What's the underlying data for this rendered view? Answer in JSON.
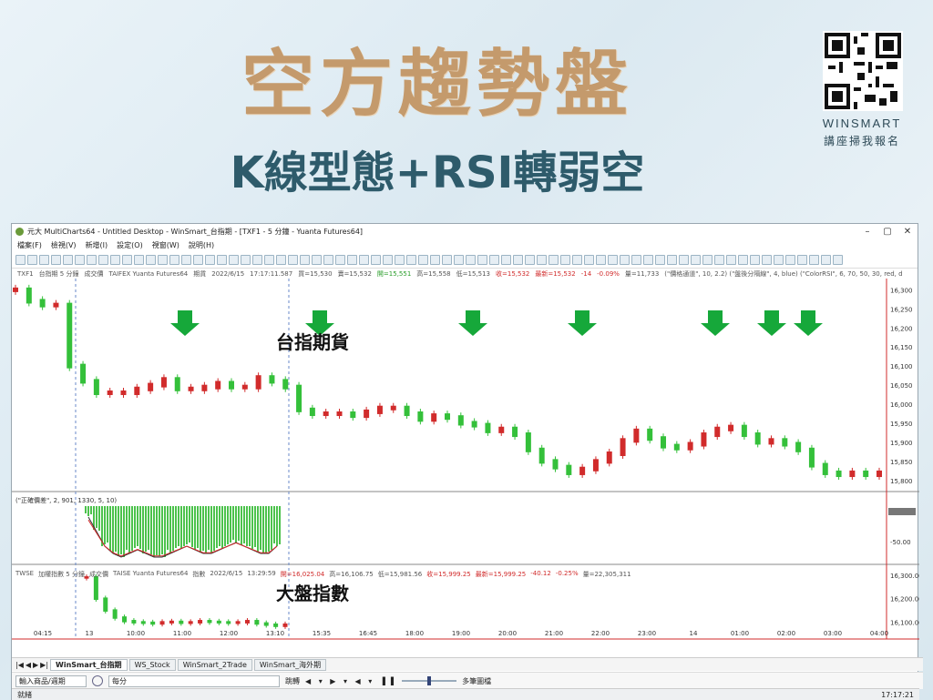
{
  "banner": {
    "title": "空方趨勢盤",
    "subtitle": "K線型態+RSI轉弱空",
    "brand": "WINSMART",
    "brand_sub": "講座掃我報名"
  },
  "window": {
    "title": "元大 MultiCharts64 - Untitled Desktop - WinSmart_台指期 - [TXF1 - 5 分鐘 - Yuanta Futures64]",
    "menu": [
      "檔案(F)",
      "檢視(V)",
      "新增(I)",
      "設定(O)",
      "視窗(W)",
      "說明(H)"
    ],
    "chart_info": {
      "symbol": "TXF1",
      "name": "台指期 5 分鐘",
      "vol_label": "成交價",
      "exchange": "TAIFEX Yuanta Futures64",
      "type": "期貨",
      "date": "2022/6/15",
      "time": "17:17:11.587",
      "buy": "買=15,530",
      "sell": "賣=15,532",
      "open": "開=15,551",
      "high": "高=15,558",
      "low": "低=15,513",
      "close": "收=15,532",
      "last": "最新=15,532",
      "change": "-14",
      "change_pct": "-0.09%",
      "volume": "量=11,733",
      "studies": "(\"價格通道\", 10, 2.2) (\"盤後分隔線\", 4, blue) (\"ColorRSI\", 6, 70, 50, 30, red, d"
    },
    "rsi_info": "(\"正確價差\", 2, 901, 1330, 5, 10)",
    "index_info": {
      "symbol": "TWSE",
      "name": "加權指數 5 分鐘",
      "vol_label": "成交價",
      "exchange": "TAISE Yuanta Futures64",
      "type": "指數",
      "date": "2022/6/15",
      "time": "13:29:59",
      "open": "開=16,025.04",
      "high": "高=16,106.75",
      "low": "低=15,981.56",
      "close": "收=15,999.25",
      "last": "最新=15,999.25",
      "change": "-40.12",
      "change_pct": "-0.25%",
      "volume": "量=22,305,311"
    },
    "tabs": [
      "WinSmart_台指期",
      "WS_Stock",
      "WinSmart_2Trade",
      "WinSmart_海外期"
    ],
    "bottom": {
      "input_placeholder": "輸入商品/週期",
      "period": "每分",
      "jump": "跳轉",
      "status": "多筆圖檔"
    },
    "status_left": "就緒",
    "status_time": "17:17:21"
  },
  "annotations": {
    "futures": "台指期貨",
    "index": "大盤指數"
  },
  "colors": {
    "up": "#d12b2b",
    "down": "#34c03a",
    "arrow": "#16a83a",
    "rsi_bar": "#4cc24c"
  },
  "chart_data": [
    {
      "type": "line",
      "title": "台指期貨",
      "x_ticks": [
        "04:15",
        "13",
        "10:00",
        "11:00",
        "12:00",
        "13:10",
        "15:35",
        "16:45",
        "18:00",
        "19:00",
        "20:00",
        "21:00",
        "22:00",
        "23:00",
        "14",
        "01:00",
        "02:00",
        "03:00",
        "04:00"
      ],
      "y_ticks": [
        16300,
        16250,
        16200,
        16150,
        16100,
        16050,
        16000,
        15950,
        15900,
        15850,
        15800
      ],
      "ylim": [
        15790,
        16320
      ],
      "close": [
        16300,
        16270,
        16260,
        16260,
        16100,
        16060,
        16030,
        16030,
        16030,
        16040,
        16050,
        16065,
        16040,
        16040,
        16045,
        16055,
        16045,
        16045,
        16070,
        16060,
        16045,
        15985,
        15975,
        15975,
        15975,
        15970,
        15980,
        15990,
        15990,
        15975,
        15960,
        15970,
        15965,
        15950,
        15945,
        15930,
        15935,
        15920,
        15880,
        15850,
        15835,
        15820,
        15830,
        15850,
        15870,
        15905,
        15930,
        15910,
        15890,
        15885,
        15895,
        15920,
        15935,
        15940,
        15920,
        15900,
        15905,
        15895,
        15880,
        15840,
        15820,
        15815,
        15820,
        15815,
        15820
      ],
      "arrows_at": [
        190,
        338,
        506,
        626,
        772,
        834,
        874
      ]
    },
    {
      "type": "bar",
      "title": "RSI",
      "y_ticks": [
        -50
      ],
      "bars": "green histogram 09:00-13:30",
      "values": [
        -2,
        -6,
        -10,
        -12,
        -13,
        -12,
        -11,
        -12,
        -13,
        -13,
        -12,
        -11,
        -10,
        -11,
        -12,
        -12,
        -11,
        -10,
        -9,
        -10,
        -11,
        -12,
        -12,
        -10
      ]
    },
    {
      "type": "line",
      "title": "大盤指數",
      "y_ticks": [
        16300,
        16200,
        16100
      ],
      "ylim": [
        16060,
        16330
      ],
      "close": [
        16290,
        16200,
        16150,
        16120,
        16105,
        16100,
        16098,
        16095,
        16100,
        16102,
        16098,
        16100,
        16105,
        16102,
        16100,
        16098,
        16100,
        16105,
        16095,
        16090,
        16085,
        16090
      ]
    }
  ]
}
